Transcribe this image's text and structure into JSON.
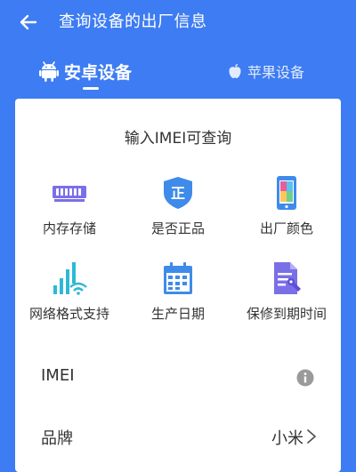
{
  "header": {
    "title": "查询设备的出厂信息"
  },
  "tabs": [
    {
      "label": "安卓设备",
      "icon": "android-icon",
      "selected": true
    },
    {
      "label": "苹果设备",
      "icon": "apple-icon",
      "selected": false
    }
  ],
  "card": {
    "title": "输入IMEI可查询",
    "features": [
      {
        "label": "内存存储",
        "icon": "memory-chip-icon"
      },
      {
        "label": "是否正品",
        "icon": "genuine-shield-icon"
      },
      {
        "label": "出厂颜色",
        "icon": "phone-color-icon"
      },
      {
        "label": "网络格式支持",
        "icon": "signal-wifi-icon"
      },
      {
        "label": "生产日期",
        "icon": "calendar-icon"
      },
      {
        "label": "保修到期时间",
        "icon": "warranty-document-icon"
      }
    ],
    "shield_char": "正",
    "rows": [
      {
        "label": "IMEI",
        "value": ""
      },
      {
        "label": "品牌",
        "value": "小米"
      }
    ]
  },
  "colors": {
    "primary": "#3D7CF2",
    "purple": "#7B6FE8",
    "teal": "#2FB8D6",
    "blue": "#3E8BEA"
  }
}
